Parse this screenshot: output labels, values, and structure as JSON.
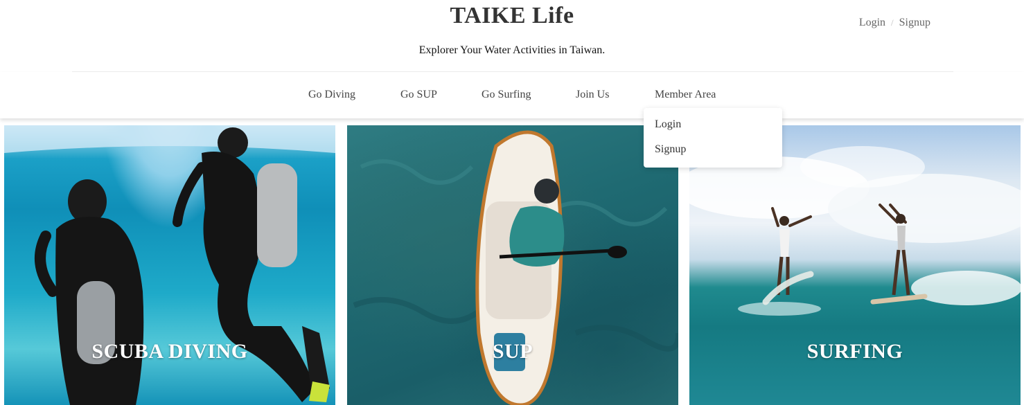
{
  "header": {
    "brand": "TAIKE Life",
    "tagline": "Explorer Your Water Activities in Taiwan.",
    "auth": {
      "login_label": "Login",
      "separator": "/",
      "signup_label": "Signup"
    }
  },
  "nav": {
    "items": [
      {
        "label": "Go Diving"
      },
      {
        "label": "Go SUP"
      },
      {
        "label": "Go Surfing"
      },
      {
        "label": "Join Us"
      },
      {
        "label": "Member Area"
      }
    ]
  },
  "dropdown": {
    "items": [
      {
        "label": "Login"
      },
      {
        "label": "Signup"
      }
    ]
  },
  "cards": [
    {
      "title": "SCUBA DIVING"
    },
    {
      "title": "SUP"
    },
    {
      "title": "SURFING"
    }
  ],
  "colors": {
    "text_dark": "#333333",
    "nav_text": "#444444",
    "auth_text": "#666666",
    "card_title": "#ffffff"
  }
}
